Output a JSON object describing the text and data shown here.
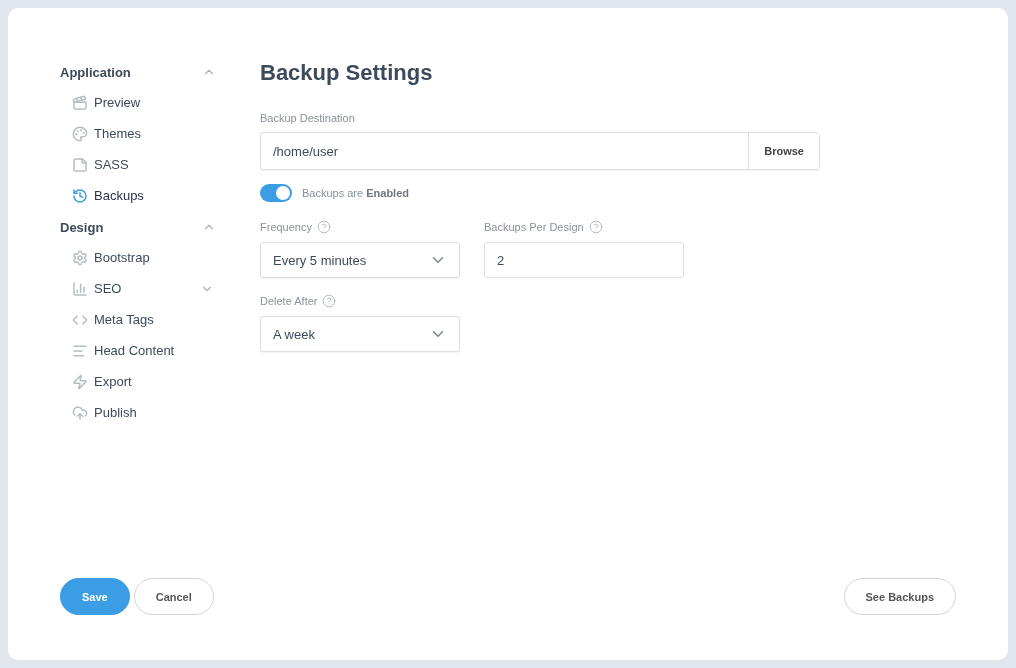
{
  "sidebar": {
    "groups": [
      {
        "title": "Application",
        "expanded": true,
        "items": [
          {
            "label": "Preview",
            "selected": false
          },
          {
            "label": "Themes",
            "selected": false
          },
          {
            "label": "SASS",
            "selected": false
          },
          {
            "label": "Backups",
            "selected": true
          }
        ]
      },
      {
        "title": "Design",
        "expanded": true,
        "items": [
          {
            "label": "Bootstrap",
            "selected": false
          },
          {
            "label": "SEO",
            "selected": false,
            "expanded": false
          },
          {
            "label": "Meta Tags",
            "selected": false
          },
          {
            "label": "Head Content",
            "selected": false
          },
          {
            "label": "Export",
            "selected": false
          },
          {
            "label": "Publish",
            "selected": false
          }
        ]
      }
    ]
  },
  "main": {
    "title": "Backup Settings",
    "destination": {
      "label": "Backup Destination",
      "value": "/home/user",
      "button": "Browse"
    },
    "toggle": {
      "label": "Backups are **Enabled**",
      "on": true
    },
    "fields": [
      {
        "kind": "select",
        "label": "Frequency",
        "value": "Every 5 minutes"
      },
      {
        "kind": "input",
        "label": "Backups Per Design",
        "value": "2"
      },
      {
        "kind": "select",
        "label": "Delete After",
        "value": "A week"
      }
    ]
  },
  "footer": {
    "save": "Save",
    "cancel": "Cancel",
    "see": "See Backups"
  }
}
